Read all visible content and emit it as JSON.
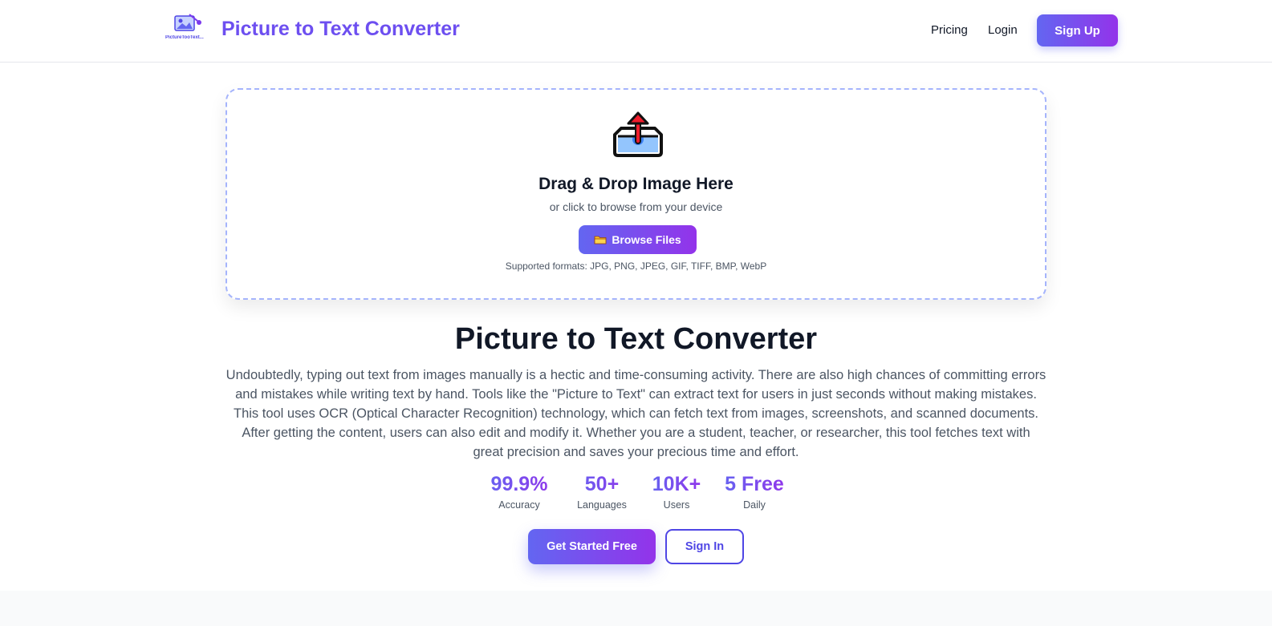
{
  "header": {
    "logo_caption": "PictureTooText...",
    "brand_title": "Picture to Text Converter",
    "nav": {
      "pricing": "Pricing",
      "login": "Login"
    },
    "signup_label": "Sign Up"
  },
  "upload": {
    "icon": "upload-tray-icon",
    "title": "Drag & Drop Image Here",
    "subtitle": "or click to browse from your device",
    "browse_label": "Browse Files",
    "browse_icon": "folder-icon",
    "formats": "Supported formats: JPG, PNG, JPEG, GIF, TIFF, BMP, WebP"
  },
  "hero": {
    "title": "Picture to Text Converter",
    "description": "Undoubtedly, typing out text from images manually is a hectic and time-consuming activity. There are also high chances of committing errors and mistakes while writing text by hand. Tools like the \"Picture to Text\" can extract text for users in just seconds without making mistakes. This tool uses OCR (Optical Character Recognition) technology, which can fetch text from images, screenshots, and scanned documents. After getting the content, users can also edit and modify it. Whether you are a student, teacher, or researcher, this tool fetches text with great precision and saves your precious time and effort."
  },
  "stats": [
    {
      "value": "99.9%",
      "label": "Accuracy"
    },
    {
      "value": "50+",
      "label": "Languages"
    },
    {
      "value": "10K+",
      "label": "Users"
    },
    {
      "value": "5 Free",
      "label": "Daily"
    }
  ],
  "cta": {
    "primary_label": "Get Started Free",
    "secondary_label": "Sign In"
  },
  "colors": {
    "accent_start": "#6366f1",
    "accent_end": "#9333ea",
    "dropzone_border": "#a5b4fc"
  }
}
